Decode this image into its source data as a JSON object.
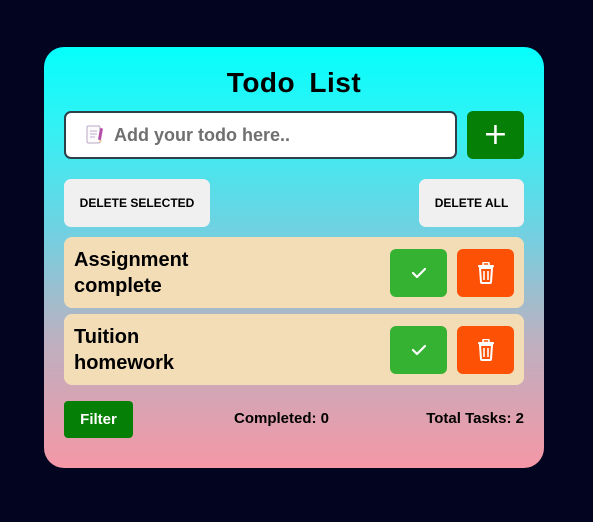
{
  "app": {
    "title": "Todo List"
  },
  "input": {
    "placeholder": "Add your todo here..",
    "value": "",
    "add_label": "+"
  },
  "actions": {
    "delete_selected_label": "DELETE SELECTED",
    "delete_all_label": "DELETE ALL"
  },
  "todos": [
    {
      "text": "Assignment complete",
      "done_icon": "check-icon",
      "delete_icon": "trash-icon"
    },
    {
      "text": "Tuition homework",
      "done_icon": "check-icon",
      "delete_icon": "trash-icon"
    }
  ],
  "footer": {
    "filter_label": "Filter",
    "completed_text": "Completed: 0",
    "total_text": "Total Tasks: 2"
  },
  "colors": {
    "page_background": "#03041f",
    "gradient_top": "#04fffc",
    "gradient_bottom": "#f597a6",
    "primary_green": "#067f06",
    "done_green": "#36b232",
    "delete_orange": "#fd5206",
    "item_background": "#f3ddb7",
    "secondary_button": "#f0f0f0"
  }
}
